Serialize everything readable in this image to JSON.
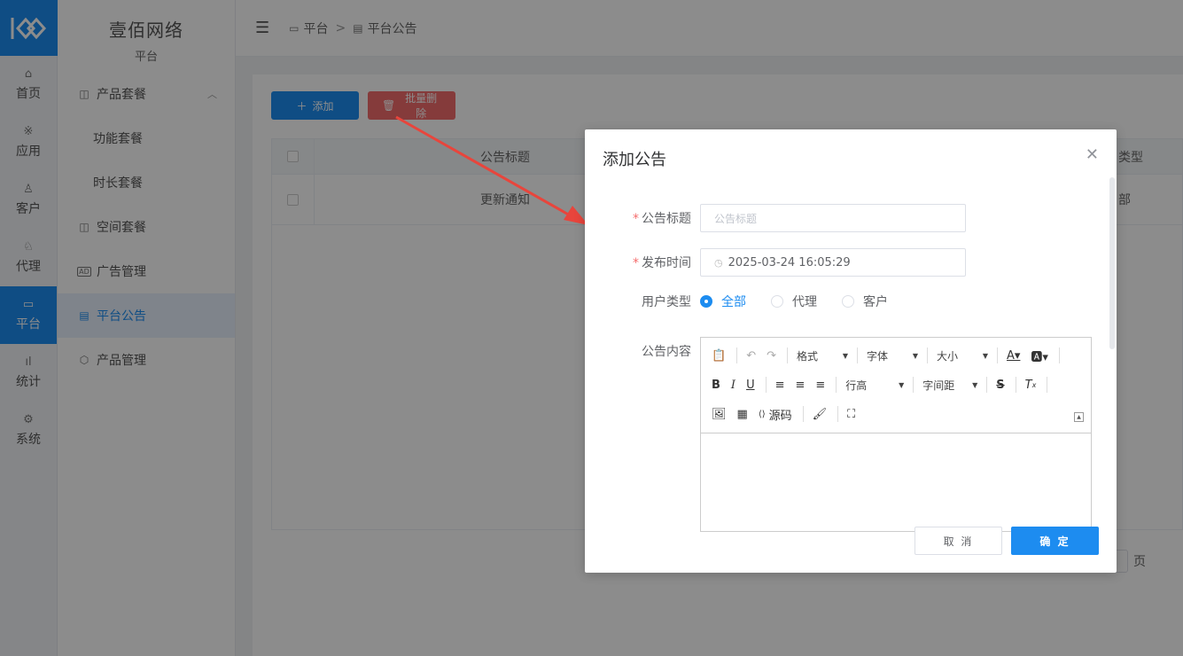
{
  "brand": {
    "name": "壹佰网络",
    "section": "平台"
  },
  "rail": [
    {
      "icon": "home-icon",
      "glyph": "⌂",
      "label": "首页"
    },
    {
      "icon": "apps-icon",
      "glyph": "※",
      "label": "应用"
    },
    {
      "icon": "customer-icon",
      "glyph": "♙",
      "label": "客户"
    },
    {
      "icon": "agent-icon",
      "glyph": "♘",
      "label": "代理"
    },
    {
      "icon": "platform-icon",
      "glyph": "▭",
      "label": "平台",
      "active": true
    },
    {
      "icon": "stats-icon",
      "glyph": "ıl",
      "label": "统计"
    },
    {
      "icon": "system-icon",
      "glyph": "⚙",
      "label": "系统"
    }
  ],
  "submenu": [
    {
      "icon": "camera-icon",
      "glyph": "◫",
      "label": "产品套餐",
      "expandable": true
    },
    {
      "label": "功能套餐",
      "sub": true
    },
    {
      "label": "时长套餐",
      "sub": true
    },
    {
      "icon": "camera-icon",
      "glyph": "◫",
      "label": "空间套餐"
    },
    {
      "icon": "ad-icon",
      "glyph": "AD",
      "label": "广告管理"
    },
    {
      "icon": "notice-icon",
      "glyph": "▤",
      "label": "平台公告",
      "active": true
    },
    {
      "icon": "product-icon",
      "glyph": "⬡",
      "label": "产品管理"
    }
  ],
  "breadcrumb": {
    "first": "平台",
    "separator": ">",
    "second": "平台公告"
  },
  "toolbar": {
    "add_label": "添加",
    "batch_delete_label": "批量删除"
  },
  "table": {
    "header_title": "公告标题",
    "header_type": "类型",
    "rows": [
      {
        "title": "更新通知",
        "type": "部"
      }
    ]
  },
  "pager": {
    "unit": "页"
  },
  "modal": {
    "title": "添加公告",
    "fields": {
      "title_label": "公告标题",
      "title_placeholder": "公告标题",
      "time_label": "发布时间",
      "time_value": "2025-03-24 16:05:29",
      "user_type_label": "用户类型",
      "user_type_options": [
        "全部",
        "代理",
        "客户"
      ],
      "user_type_selected": "全部",
      "content_label": "公告内容"
    },
    "editor": {
      "format_label": "格式",
      "font_label": "字体",
      "size_label": "大小",
      "line_height_label": "行高",
      "letter_spacing_label": "字间距",
      "source_label": "源码"
    },
    "cancel_label": "取 消",
    "confirm_label": "确 定"
  },
  "colors": {
    "primary": "#1d8cf0",
    "danger": "#f36c6c",
    "annotation": "#e8453c"
  }
}
